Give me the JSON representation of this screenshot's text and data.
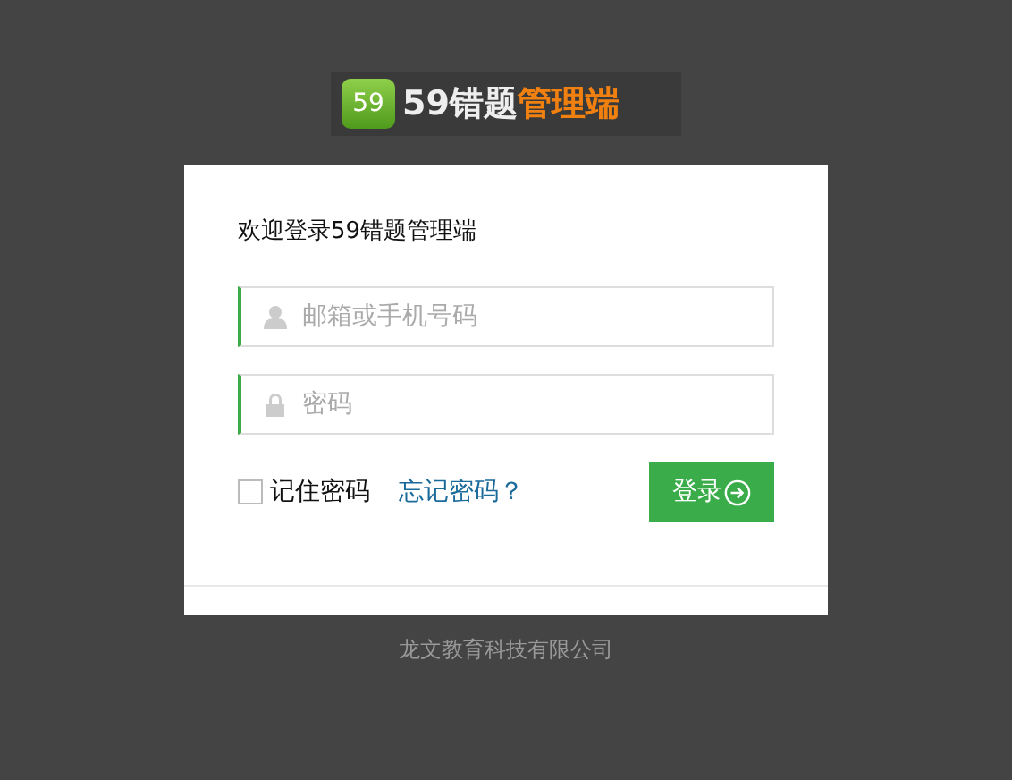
{
  "logo": {
    "badge": "59",
    "title_main": "59错题",
    "title_accent": "管理端"
  },
  "login_form": {
    "heading": "欢迎登录59错题管理端",
    "fields": [
      {
        "kind": "user",
        "placeholder": "邮箱或手机号码"
      },
      {
        "kind": "password",
        "placeholder": "密码"
      }
    ],
    "remember": {
      "label": "记住密码",
      "checked": false
    },
    "forgot_link": "忘记密码？",
    "submit": "登录"
  },
  "footer": "龙文教育科技有限公司"
}
